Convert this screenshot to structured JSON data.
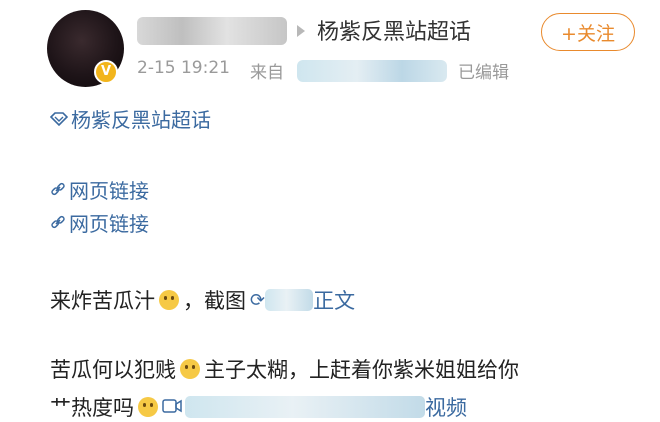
{
  "post": {
    "topic_title": "杨紫反黑站超话",
    "follow_label": "+关注",
    "time": "2-15 19:21",
    "from_label": "来自",
    "edited_label": "已编辑"
  },
  "content": {
    "topic_tag": "杨紫反黑站超话",
    "link1": "网页链接",
    "link2": "网页链接",
    "para1_before": "来炸苦瓜汁",
    "para1_mid": "，截图",
    "para1_link": "正文",
    "para2": "苦瓜何以犯贱",
    "para2_tail": "主子太糊，上赶着你紫米姐姐给你",
    "para3": "艹热度吗",
    "para3_link": "视频"
  },
  "icons": {
    "verified": "verified-badge-icon",
    "topic": "topic-diamond-icon",
    "link": "link-chain-icon",
    "video": "video-icon",
    "refresh": "loop-icon"
  }
}
